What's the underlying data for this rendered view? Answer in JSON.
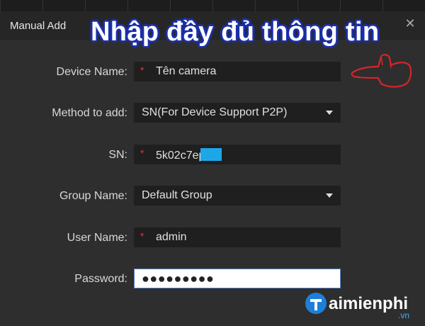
{
  "dialog": {
    "title": "Manual Add",
    "close_icon": "close-icon"
  },
  "overlay": {
    "heading": "Nhập đầy đủ thông tin",
    "pointer_icon": "pointer-hand-icon",
    "pointer_color": "#d8242b"
  },
  "form": {
    "device_name": {
      "label": "Device Name:",
      "value": "Tên camera",
      "required": "*"
    },
    "method": {
      "label": "Method to add:",
      "value": "SN(For Device Support P2P)"
    },
    "sn": {
      "label": "SN:",
      "value": "5k02c7ep",
      "required": "*"
    },
    "group": {
      "label": "Group Name:",
      "value": "Default Group"
    },
    "user": {
      "label": "User Name:",
      "value": "admin",
      "required": "*"
    },
    "password": {
      "label": "Password:",
      "value": "●●●●●●●●●"
    }
  },
  "brand": {
    "name": "aimienphi",
    "suffix": ".vn",
    "logo_icon": "taimienphi-logo-icon",
    "accent_color": "#1e7fd8"
  },
  "colors": {
    "background": "#2e2e2e",
    "field_bg": "#1f1f1f",
    "highlight": "#1ea7e8",
    "required": "#e0323c"
  }
}
